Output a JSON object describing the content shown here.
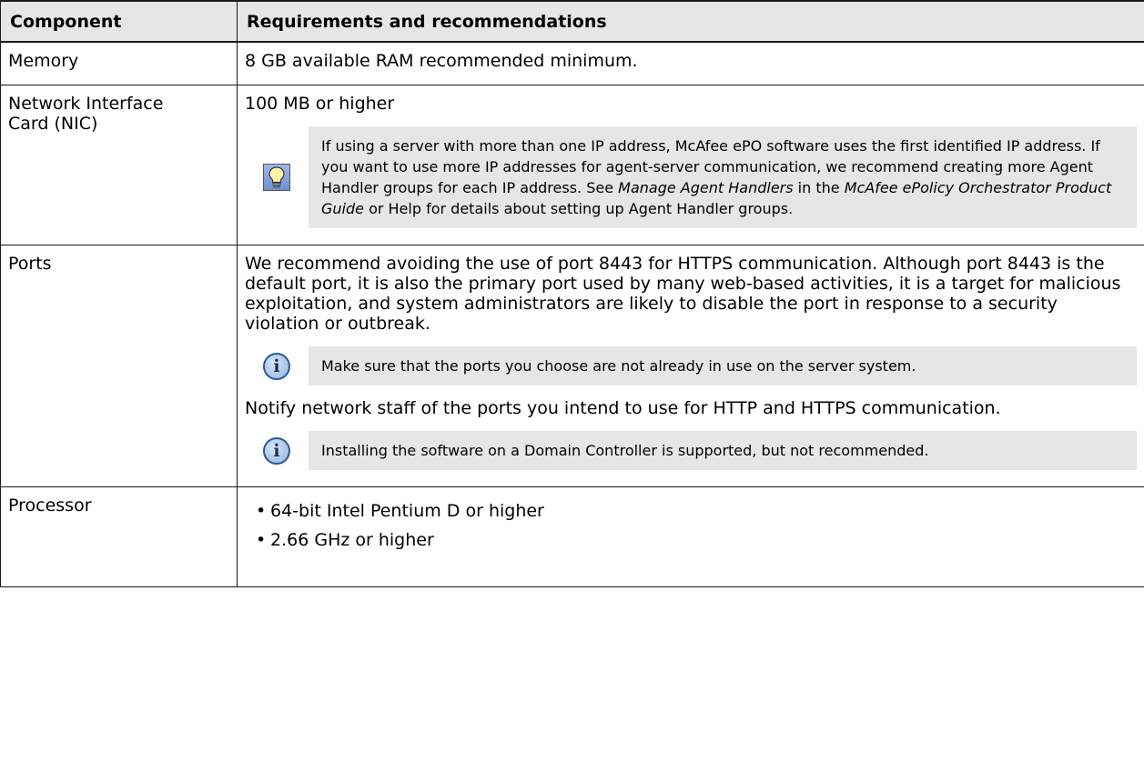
{
  "table": {
    "headers": {
      "component": "Component",
      "requirements": "Requirements and recommendations"
    },
    "memory": {
      "label": "Memory",
      "text": "8 GB available RAM recommended minimum."
    },
    "nic": {
      "label_line1": "Network Interface",
      "label_line2": "Card (NIC)",
      "text": "100 MB or higher",
      "tip": {
        "icon": "lightbulb-icon",
        "part1": "If using a server with more than one IP address, McAfee ePO software uses the first identified IP address. If you want to use more IP addresses for agent-server communication, we recommend creating more Agent Handler groups for each IP address. See ",
        "italic1": "Manage Agent Handlers",
        "part2": " in the ",
        "italic2": "McAfee ePolicy Orchestrator Product Guide",
        "part3": " or Help for details about setting up Agent Handler groups."
      }
    },
    "ports": {
      "label": "Ports",
      "para1": "We recommend avoiding the use of port 8443 for HTTPS communication. Although port 8443 is the default port, it is also the primary port used by many web-based activities, it is a target for malicious exploitation, and system administrators are likely to disable the port in response to a security violation or outbreak.",
      "note1": "Make sure that the ports you choose are not already in use on the server system.",
      "para2": "Notify network staff of the ports you intend to use for HTTP and HTTPS communication.",
      "note2": "Installing the software on a Domain Controller is supported, but not recommended.",
      "note_icon": "info-icon"
    },
    "processor": {
      "label": "Processor",
      "items": [
        "64-bit Intel Pentium D or higher",
        "2.66 GHz or higher"
      ],
      "bullet": "•"
    }
  }
}
